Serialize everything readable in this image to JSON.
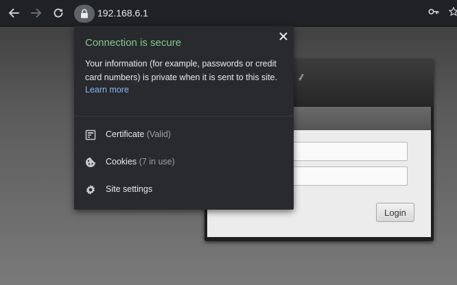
{
  "toolbar": {
    "back_icon": "arrow-left-icon",
    "forward_icon": "arrow-right-icon",
    "reload_icon": "reload-icon",
    "url": "192.168.6.1",
    "lock_icon": "lock-icon",
    "key_icon": "key-icon",
    "star_icon": "star-icon"
  },
  "popup": {
    "title": "Connection is secure",
    "description": "Your information (for example, passwords or credit card numbers) is private when it is sent to this site.",
    "learn_more": "Learn more",
    "close_icon": "close-icon",
    "rows": [
      {
        "label": "Certificate",
        "sub": "(Valid)",
        "icon": "certificate-icon"
      },
      {
        "label": "Cookies",
        "sub": "(7 in use)",
        "icon": "cookie-icon"
      },
      {
        "label": "Site settings",
        "sub": "",
        "icon": "gear-icon"
      }
    ]
  },
  "login": {
    "button_label": "Login",
    "logo_mark": "®"
  },
  "colors": {
    "toolbar_bg": "#202124",
    "popup_bg": "#292a2d",
    "secure_green": "#81c995",
    "link_blue": "#8ab4f8"
  }
}
